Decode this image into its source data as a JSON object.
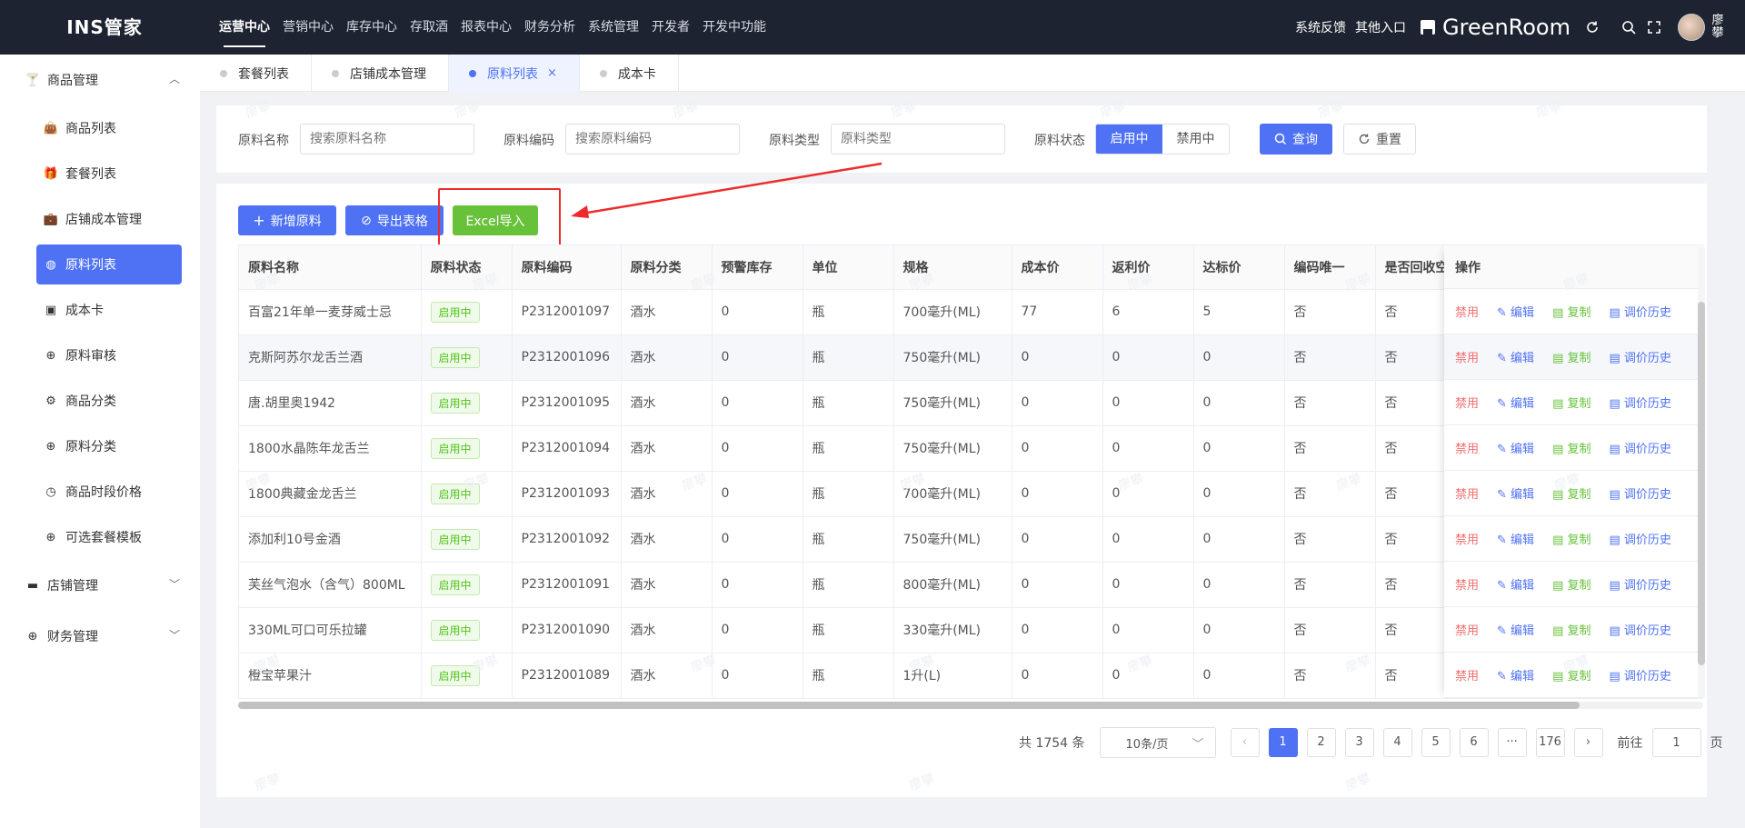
{
  "app": {
    "logo": "INS管家",
    "top_nav": [
      "运营中心",
      "营销中心",
      "库存中心",
      "存取酒",
      "报表中心",
      "财务分析",
      "系统管理",
      "开发者",
      "开发中功能"
    ],
    "feedback": "系统反馈",
    "other_entry": "其他入口",
    "brand": "GreenRoom",
    "user_name": "廖攀"
  },
  "sidebar": {
    "group1": "商品管理",
    "items": [
      "商品列表",
      "套餐列表",
      "店铺成本管理",
      "原料列表",
      "成本卡",
      "原料审核",
      "商品分类",
      "原料分类",
      "商品时段价格",
      "可选套餐模板"
    ],
    "group2": "店铺管理",
    "group3": "财务管理"
  },
  "tabs": [
    "套餐列表",
    "店铺成本管理",
    "原料列表",
    "成本卡"
  ],
  "filters": {
    "name_label": "原料名称",
    "name_placeholder": "搜索原料名称",
    "code_label": "原料编码",
    "code_placeholder": "搜索原料编码",
    "type_label": "原料类型",
    "type_placeholder": "原料类型",
    "status_label": "原料状态",
    "status_on": "启用中",
    "status_off": "禁用中",
    "query": "查询",
    "reset": "重置"
  },
  "actions": {
    "add": "新增原料",
    "export": "导出表格",
    "import": "Excel导入"
  },
  "table": {
    "headers": [
      "原料名称",
      "原料状态",
      "原料编码",
      "原料分类",
      "预警库存",
      "单位",
      "规格",
      "成本价",
      "返利价",
      "达标价",
      "编码唯一",
      "是否回收空",
      "操作"
    ],
    "rows": [
      [
        "百富21年单一麦芽威士忌",
        "启用中",
        "P2312001097",
        "酒水",
        "0",
        "瓶",
        "700毫升(ML)",
        "77",
        "6",
        "5",
        "否",
        "否"
      ],
      [
        "克斯阿苏尔龙舌兰酒",
        "启用中",
        "P2312001096",
        "酒水",
        "0",
        "瓶",
        "750毫升(ML)",
        "0",
        "0",
        "0",
        "否",
        "否"
      ],
      [
        "唐.胡里奥1942",
        "启用中",
        "P2312001095",
        "酒水",
        "0",
        "瓶",
        "750毫升(ML)",
        "0",
        "0",
        "0",
        "否",
        "否"
      ],
      [
        "1800水晶陈年龙舌兰",
        "启用中",
        "P2312001094",
        "酒水",
        "0",
        "瓶",
        "750毫升(ML)",
        "0",
        "0",
        "0",
        "否",
        "否"
      ],
      [
        "1800典藏金龙舌兰",
        "启用中",
        "P2312001093",
        "酒水",
        "0",
        "瓶",
        "700毫升(ML)",
        "0",
        "0",
        "0",
        "否",
        "否"
      ],
      [
        "添加利10号金酒",
        "启用中",
        "P2312001092",
        "酒水",
        "0",
        "瓶",
        "750毫升(ML)",
        "0",
        "0",
        "0",
        "否",
        "否"
      ],
      [
        "芙丝气泡水（含气）800ML",
        "启用中",
        "P2312001091",
        "酒水",
        "0",
        "瓶",
        "800毫升(ML)",
        "0",
        "0",
        "0",
        "否",
        "否"
      ],
      [
        "330ML可口可乐拉罐",
        "启用中",
        "P2312001090",
        "酒水",
        "0",
        "瓶",
        "330毫升(ML)",
        "0",
        "0",
        "0",
        "否",
        "否"
      ],
      [
        "橙宝苹果汁",
        "启用中",
        "P2312001089",
        "酒水",
        "0",
        "瓶",
        "1升(L)",
        "0",
        "0",
        "0",
        "否",
        "否"
      ]
    ],
    "ops": [
      "禁用",
      "编辑",
      "复制",
      "调价历史"
    ]
  },
  "pagination": {
    "total": "共 1754 条",
    "page_size": "10条/页",
    "pages": [
      "1",
      "2",
      "3",
      "4",
      "5",
      "6",
      "···",
      "176"
    ],
    "goto_label": "前往",
    "goto_value": "1",
    "page_suffix": "页"
  },
  "watermark": "廖攀",
  "colors": {
    "primary": "#4f72f5",
    "success": "#67c23a",
    "danger": "#f56c6c",
    "annotation": "#ee2b2b"
  }
}
